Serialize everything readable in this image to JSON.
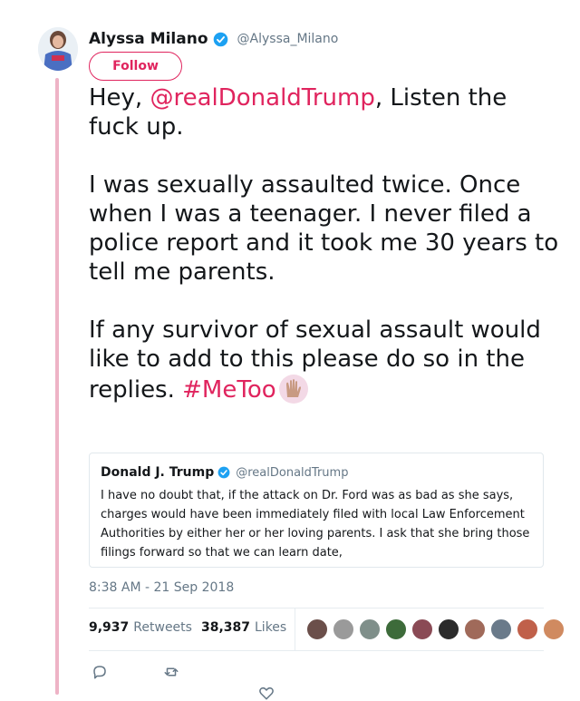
{
  "tweet": {
    "author_name": "Alyssa Milano",
    "author_handle": "@Alyssa_Milano",
    "follow_label": "Follow",
    "text_part1": "Hey, ",
    "mention": "@realDonaldTrump",
    "text_part2": ", Listen the fuck up.\n\nI was sexually assaulted twice. Once when I was a teenager. I never filed a police report and it took me 30 years to tell me parents.\n\nIf any survivor of sexual assault would like to add to this please do so in the replies. ",
    "hashtag": "#MeToo",
    "emoji": "raised-hands-icon",
    "timestamp": "8:38 AM - 21 Sep 2018",
    "retweets_count": "9,937",
    "retweets_label": "Retweets",
    "likes_count": "38,387",
    "likes_label": "Likes"
  },
  "quoted_tweet": {
    "author_name": "Donald J. Trump",
    "author_handle": "@realDonaldTrump",
    "text": "I have no doubt that, if the attack on Dr. Ford was as bad as she says, charges would have been immediately filed with local Law Enforcement Authorities by either her or her loving parents. I ask that she bring those filings forward so that we can learn  date,"
  },
  "likers": [
    {
      "color": "#6b4f4a"
    },
    {
      "color": "#9a9a9a"
    },
    {
      "color": "#7f8f8a"
    },
    {
      "color": "#3d6b3a"
    },
    {
      "color": "#8a4a55"
    },
    {
      "color": "#2b2b2b"
    },
    {
      "color": "#a06a5a"
    },
    {
      "color": "#6a7a8a"
    },
    {
      "color": "#c0604a"
    },
    {
      "color": "#d08a60"
    }
  ],
  "colors": {
    "accent": "#e0245e",
    "verified": "#1da1f2",
    "thread_line": "#eeb3c6",
    "muted": "#657786"
  }
}
